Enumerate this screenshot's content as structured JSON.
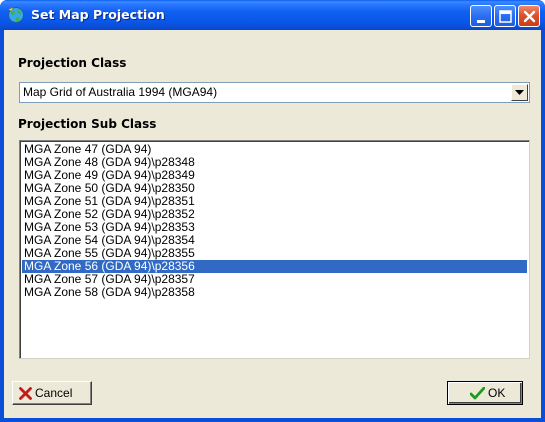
{
  "window": {
    "title": "Set Map Projection"
  },
  "projection_class": {
    "label": "Projection Class",
    "selected_value": "Map Grid of Australia 1994 (MGA94)"
  },
  "projection_sub_class": {
    "label": "Projection Sub Class",
    "items": [
      "MGA Zone 47 (GDA 94)",
      "MGA Zone 48 (GDA 94)\\p28348",
      "MGA Zone 49 (GDA 94)\\p28349",
      "MGA Zone 50 (GDA 94)\\p28350",
      "MGA Zone 51 (GDA 94)\\p28351",
      "MGA Zone 52 (GDA 94)\\p28352",
      "MGA Zone 53 (GDA 94)\\p28353",
      "MGA Zone 54 (GDA 94)\\p28354",
      "MGA Zone 55 (GDA 94)\\p28355",
      "MGA Zone 56 (GDA 94)\\p28356",
      "MGA Zone 57 (GDA 94)\\p28357",
      "MGA Zone 58 (GDA 94)\\p28358"
    ],
    "selected_index": 9
  },
  "buttons": {
    "cancel_label": "Cancel",
    "ok_label": "OK"
  },
  "icons": {
    "app": "globe-app-icon",
    "minimize": "minimize-icon",
    "maximize": "maximize-icon",
    "close": "close-icon",
    "dropdown": "chevron-down-icon",
    "cancel": "red-x-icon",
    "ok": "green-check-icon"
  },
  "colors": {
    "titlebar": "#0a58ea",
    "selection": "#316ac5",
    "close_button": "#e0502c",
    "dialog_face": "#ece9d8"
  }
}
